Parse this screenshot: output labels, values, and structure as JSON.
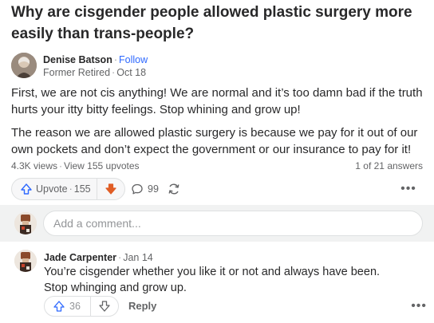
{
  "question": {
    "title": "Why are cisgender people allowed plastic surgery more easily than trans-people?"
  },
  "answer": {
    "author_name": "Denise Batson",
    "separator": "·",
    "follow_label": "Follow",
    "credential": "Former Retired",
    "date": "Oct 18",
    "paragraphs": [
      "First, we are not cis anything! We are normal and it’s too damn bad if the truth hurts your itty bitty feelings. Stop whining and grow up!",
      "The reason we are allowed plastic surgery is because we pay for it out of our own pockets and don’t expect the government or our insurance to pay for it!"
    ],
    "views": "4.3K views",
    "upvotes_link": "View 155 upvotes",
    "position": "1 of 21 answers",
    "upvote_label": "Upvote",
    "upvote_count": "155",
    "comment_count": "99",
    "more_label": "•••"
  },
  "comment_box": {
    "placeholder": "Add a comment..."
  },
  "comments": [
    {
      "author": "Jade Carpenter",
      "date": "Jan 14",
      "text": "You’re cisgender whether you like it or not and always have been. Stop whinging and grow up.",
      "upvote_count": "36",
      "reply_label": "Reply",
      "more_label": "•••"
    }
  ],
  "colors": {
    "link": "#2e69ff",
    "downvote_active": "#e05d25",
    "text": "#282829",
    "muted": "#636466"
  },
  "icons": {
    "upvote": "upvote-arrow-icon",
    "downvote": "downvote-arrow-icon",
    "comment": "comment-bubble-icon",
    "share": "share-cycle-icon",
    "more": "more-dots-icon"
  }
}
